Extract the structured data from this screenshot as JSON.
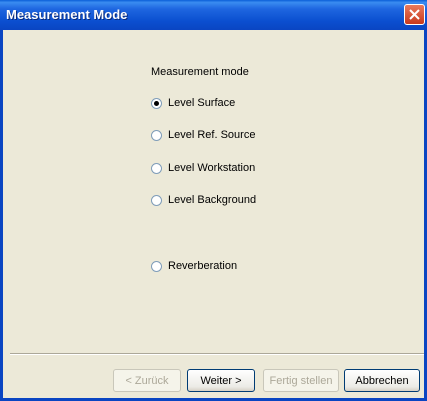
{
  "window": {
    "title": "Measurement Mode"
  },
  "group": {
    "heading": "Measurement mode"
  },
  "options": [
    {
      "label": "Level Surface",
      "selected": true
    },
    {
      "label": "Level Ref. Source",
      "selected": false
    },
    {
      "label": "Level Workstation",
      "selected": false
    },
    {
      "label": "Level Background",
      "selected": false
    },
    {
      "label": "Reverberation",
      "selected": false
    }
  ],
  "buttons": {
    "back": {
      "label": "< Zurück",
      "enabled": false
    },
    "next": {
      "label": "Weiter >",
      "enabled": true
    },
    "finish": {
      "label": "Fertig stellen",
      "enabled": false
    },
    "cancel": {
      "label": "Abbrechen",
      "enabled": true
    }
  }
}
